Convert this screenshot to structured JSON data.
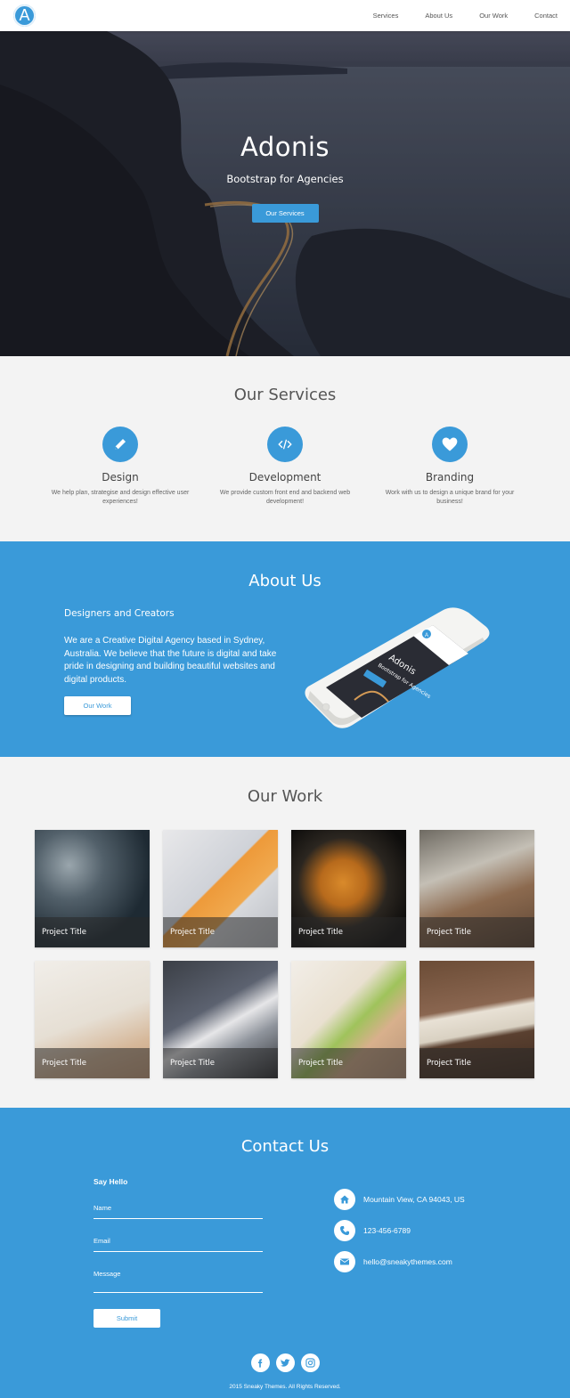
{
  "navbar": {
    "logo_letter": "A",
    "links": [
      "Services",
      "About Us",
      "Our Work",
      "Contact"
    ]
  },
  "hero": {
    "title": "Adonis",
    "subtitle": "Bootstrap for Agencies",
    "button": "Our Services"
  },
  "services": {
    "title": "Our Services",
    "items": [
      {
        "title": "Design",
        "text": "We help plan, strategise and design effective user experiences!",
        "icon": "pencil-icon"
      },
      {
        "title": "Development",
        "text": "We provide custom front end and backend web development!",
        "icon": "code-icon"
      },
      {
        "title": "Branding",
        "text": "Work with us to design a unique brand for your business!",
        "icon": "heart-icon"
      }
    ]
  },
  "about": {
    "title": "About Us",
    "subtitle": "Designers and Creators",
    "text": "We are a Creative Digital Agency based in Sydney, Australia. We believe that the future is digital and take pride in designing and building beautiful websites and digital products.",
    "button": "Our Work",
    "phone_screen": {
      "title": "Adonis",
      "subtitle": "Bootstrap for Agencies",
      "logo_letter": "A"
    }
  },
  "work": {
    "title": "Our Work",
    "tiles": [
      "Project Title",
      "Project Title",
      "Project Title",
      "Project Title",
      "Project Title",
      "Project Title",
      "Project Title",
      "Project Title"
    ]
  },
  "contact": {
    "title": "Contact Us",
    "form_title": "Say Hello",
    "name_placeholder": "Name",
    "email_placeholder": "Email",
    "message_placeholder": "Message",
    "submit": "Submit",
    "address": "Mountain View, CA 94043, US",
    "phone": "123-456-6789",
    "email": "hello@sneakythemes.com",
    "copyright": "2015 Sneaky Themes. All Rights Reserved."
  },
  "colors": {
    "accent": "#3a9ad9",
    "section_bg": "#f3f3f3"
  }
}
